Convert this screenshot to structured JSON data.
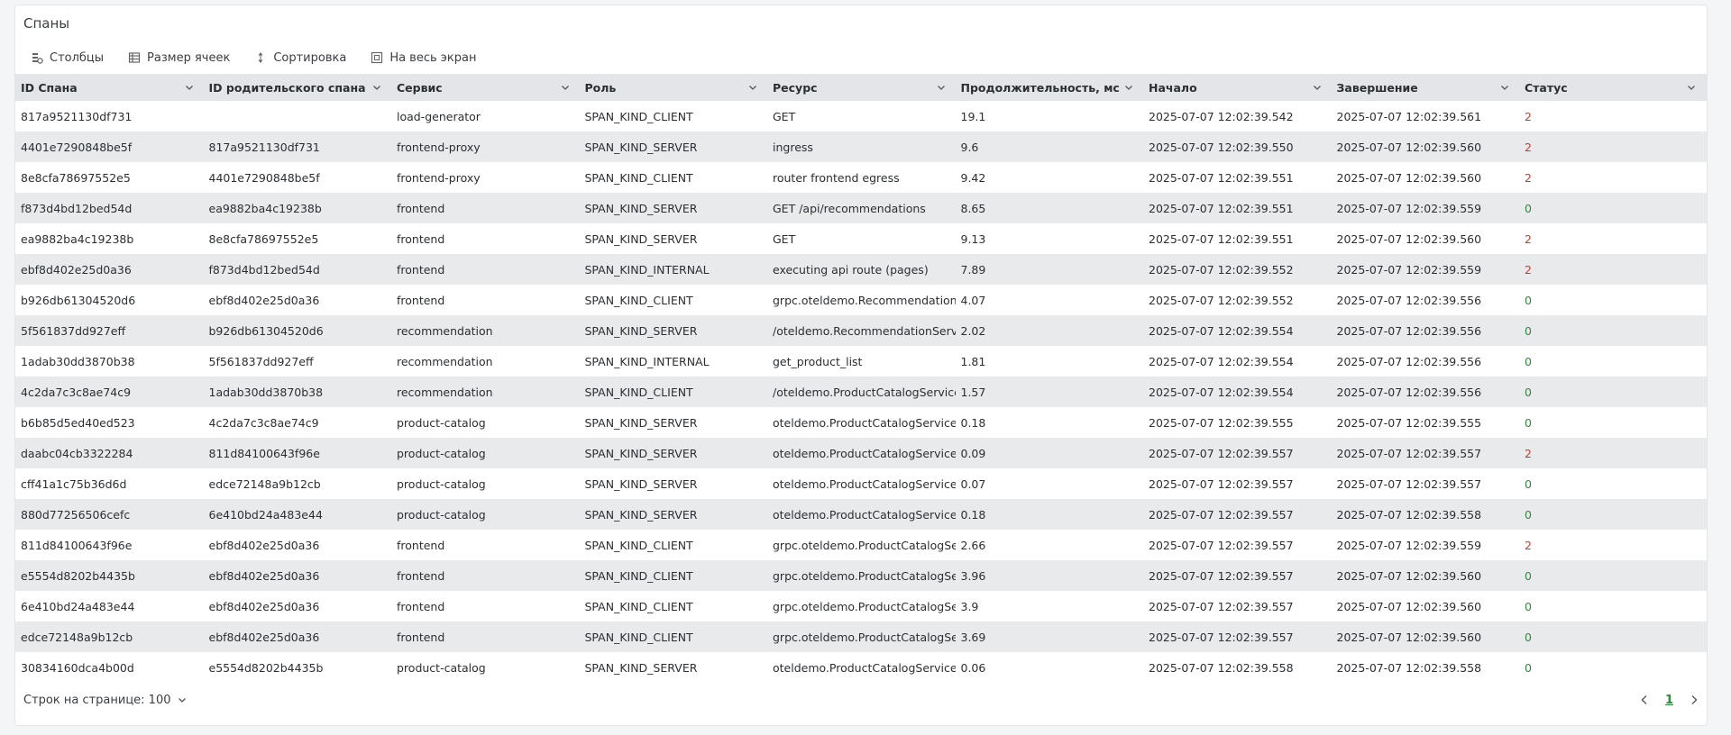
{
  "panel": {
    "title": "Спаны"
  },
  "toolbar": {
    "columns_label": "Столбцы",
    "cell_size_label": "Размер ячеек",
    "sort_label": "Сортировка",
    "fullscreen_label": "На весь экран"
  },
  "table": {
    "headers": [
      "ID Спана",
      "ID родительского спана",
      "Сервис",
      "Роль",
      "Ресурс",
      "Продолжительность, мс",
      "Начало",
      "Завершение",
      "Статус"
    ],
    "rows": [
      [
        "817a9521130df731",
        "",
        "load-generator",
        "SPAN_KIND_CLIENT",
        "GET",
        "19.1",
        "2025-07-07 12:02:39.542",
        "2025-07-07 12:02:39.561",
        "2"
      ],
      [
        "4401e7290848be5f",
        "817a9521130df731",
        "frontend-proxy",
        "SPAN_KIND_SERVER",
        "ingress",
        "9.6",
        "2025-07-07 12:02:39.550",
        "2025-07-07 12:02:39.560",
        "2"
      ],
      [
        "8e8cfa78697552e5",
        "4401e7290848be5f",
        "frontend-proxy",
        "SPAN_KIND_CLIENT",
        "router frontend egress",
        "9.42",
        "2025-07-07 12:02:39.551",
        "2025-07-07 12:02:39.560",
        "2"
      ],
      [
        "f873d4bd12bed54d",
        "ea9882ba4c19238b",
        "frontend",
        "SPAN_KIND_SERVER",
        "GET /api/recommendations",
        "8.65",
        "2025-07-07 12:02:39.551",
        "2025-07-07 12:02:39.559",
        "0"
      ],
      [
        "ea9882ba4c19238b",
        "8e8cfa78697552e5",
        "frontend",
        "SPAN_KIND_SERVER",
        "GET",
        "9.13",
        "2025-07-07 12:02:39.551",
        "2025-07-07 12:02:39.560",
        "2"
      ],
      [
        "ebf8d402e25d0a36",
        "f873d4bd12bed54d",
        "frontend",
        "SPAN_KIND_INTERNAL",
        "executing api route (pages)",
        "7.89",
        "2025-07-07 12:02:39.552",
        "2025-07-07 12:02:39.559",
        "2"
      ],
      [
        "b926db61304520d6",
        "ebf8d402e25d0a36",
        "frontend",
        "SPAN_KIND_CLIENT",
        "grpc.oteldemo.RecommendationSer",
        "4.07",
        "2025-07-07 12:02:39.552",
        "2025-07-07 12:02:39.556",
        "0"
      ],
      [
        "5f561837dd927eff",
        "b926db61304520d6",
        "recommendation",
        "SPAN_KIND_SERVER",
        "/oteldemo.RecommendationService",
        "2.02",
        "2025-07-07 12:02:39.554",
        "2025-07-07 12:02:39.556",
        "0"
      ],
      [
        "1adab30dd3870b38",
        "5f561837dd927eff",
        "recommendation",
        "SPAN_KIND_INTERNAL",
        "get_product_list",
        "1.81",
        "2025-07-07 12:02:39.554",
        "2025-07-07 12:02:39.556",
        "0"
      ],
      [
        "4c2da7c3c8ae74c9",
        "1adab30dd3870b38",
        "recommendation",
        "SPAN_KIND_CLIENT",
        "/oteldemo.ProductCatalogService/Li",
        "1.57",
        "2025-07-07 12:02:39.554",
        "2025-07-07 12:02:39.556",
        "0"
      ],
      [
        "b6b85d5ed40ed523",
        "4c2da7c3c8ae74c9",
        "product-catalog",
        "SPAN_KIND_SERVER",
        "oteldemo.ProductCatalogService/Li",
        "0.18",
        "2025-07-07 12:02:39.555",
        "2025-07-07 12:02:39.555",
        "0"
      ],
      [
        "daabc04cb3322284",
        "811d84100643f96e",
        "product-catalog",
        "SPAN_KIND_SERVER",
        "oteldemo.ProductCatalogService/Ge",
        "0.09",
        "2025-07-07 12:02:39.557",
        "2025-07-07 12:02:39.557",
        "2"
      ],
      [
        "cff41a1c75b36d6d",
        "edce72148a9b12cb",
        "product-catalog",
        "SPAN_KIND_SERVER",
        "oteldemo.ProductCatalogService/Ge",
        "0.07",
        "2025-07-07 12:02:39.557",
        "2025-07-07 12:02:39.557",
        "0"
      ],
      [
        "880d77256506cefc",
        "6e410bd24a483e44",
        "product-catalog",
        "SPAN_KIND_SERVER",
        "oteldemo.ProductCatalogService/Ge",
        "0.18",
        "2025-07-07 12:02:39.557",
        "2025-07-07 12:02:39.558",
        "0"
      ],
      [
        "811d84100643f96e",
        "ebf8d402e25d0a36",
        "frontend",
        "SPAN_KIND_CLIENT",
        "grpc.oteldemo.ProductCatalogServi",
        "2.66",
        "2025-07-07 12:02:39.557",
        "2025-07-07 12:02:39.559",
        "2"
      ],
      [
        "e5554d8202b4435b",
        "ebf8d402e25d0a36",
        "frontend",
        "SPAN_KIND_CLIENT",
        "grpc.oteldemo.ProductCatalogServi",
        "3.96",
        "2025-07-07 12:02:39.557",
        "2025-07-07 12:02:39.560",
        "0"
      ],
      [
        "6e410bd24a483e44",
        "ebf8d402e25d0a36",
        "frontend",
        "SPAN_KIND_CLIENT",
        "grpc.oteldemo.ProductCatalogServi",
        "3.9",
        "2025-07-07 12:02:39.557",
        "2025-07-07 12:02:39.560",
        "0"
      ],
      [
        "edce72148a9b12cb",
        "ebf8d402e25d0a36",
        "frontend",
        "SPAN_KIND_CLIENT",
        "grpc.oteldemo.ProductCatalogServi",
        "3.69",
        "2025-07-07 12:02:39.557",
        "2025-07-07 12:02:39.560",
        "0"
      ],
      [
        "30834160dca4b00d",
        "e5554d8202b4435b",
        "product-catalog",
        "SPAN_KIND_SERVER",
        "oteldemo.ProductCatalogService/Ge",
        "0.06",
        "2025-07-07 12:02:39.558",
        "2025-07-07 12:02:39.558",
        "0"
      ]
    ]
  },
  "footer": {
    "rows_per_page_label": "Строк на странице: 100",
    "current_page": "1"
  },
  "colors": {
    "status_error": "#d8342c",
    "status_ok": "#2e8b3d",
    "header_bg": "#e3e5e8",
    "stripe_bg": "#e9eaec"
  }
}
